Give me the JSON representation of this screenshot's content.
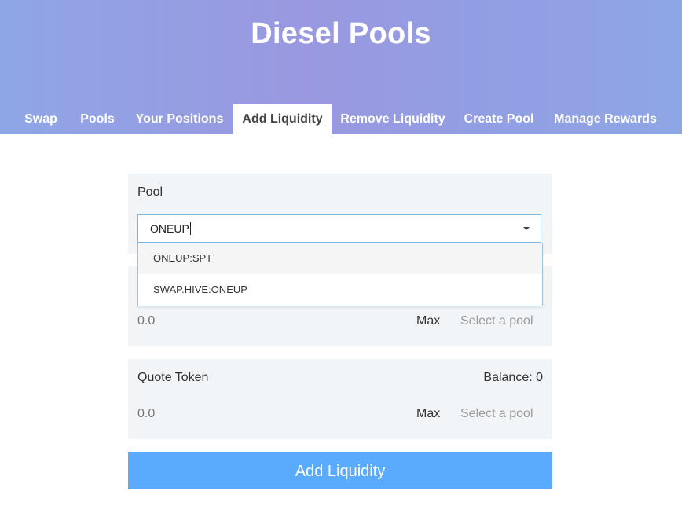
{
  "header": {
    "title": "Diesel Pools",
    "tabs": [
      "Swap",
      "Pools",
      "Your Positions",
      "Add Liquidity",
      "Remove Liquidity",
      "Create Pool",
      "Manage Rewards"
    ],
    "active_tab": "Add Liquidity"
  },
  "form": {
    "pool": {
      "label": "Pool",
      "input_value": "ONEUP",
      "options": [
        "ONEUP:SPT",
        "SWAP.HIVE:ONEUP"
      ]
    },
    "base": {
      "amount_placeholder": "0.0",
      "max_label": "Max",
      "token_placeholder": "Select a pool"
    },
    "quote": {
      "label": "Quote Token",
      "balance": "Balance: 0",
      "amount_placeholder": "0.0",
      "max_label": "Max",
      "token_placeholder": "Select a pool"
    },
    "submit_label": "Add Liquidity"
  },
  "colors": {
    "submit": "#5aabfd",
    "header_gradient": [
      "#8fa6e6",
      "#9a98e0",
      "#8ea6e6"
    ],
    "card_bg": "#f2f5f8"
  }
}
